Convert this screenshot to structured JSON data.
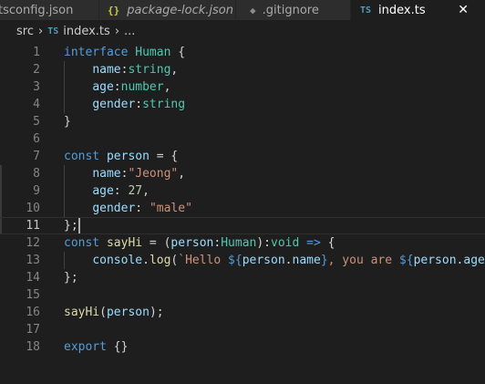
{
  "tabs": [
    {
      "label": "tsconfig.json",
      "icon": "",
      "italic": false,
      "active": false
    },
    {
      "label": "package-lock.json",
      "icon": "{}",
      "italic": true,
      "active": false
    },
    {
      "label": ".gitignore",
      "icon": "◆",
      "italic": false,
      "active": false
    },
    {
      "label": "index.ts",
      "icon": "TS",
      "italic": false,
      "active": true
    }
  ],
  "close_glyph": "✕",
  "breadcrumb": {
    "folder": "src",
    "file_icon": "TS",
    "file": "index.ts",
    "symbol": "..."
  },
  "editor": {
    "cursor_line": 11,
    "lines": [
      {
        "n": "1",
        "tokens": [
          {
            "t": "interface",
            "c": "k"
          },
          {
            "t": " ",
            "c": "p"
          },
          {
            "t": "Human",
            "c": "ty"
          },
          {
            "t": " {",
            "c": "p"
          }
        ]
      },
      {
        "n": "2",
        "tokens": [
          {
            "t": "    ",
            "c": "p"
          },
          {
            "t": "name",
            "c": "v"
          },
          {
            "t": ":",
            "c": "p"
          },
          {
            "t": "string",
            "c": "ty"
          },
          {
            "t": ",",
            "c": "p"
          }
        ]
      },
      {
        "n": "3",
        "tokens": [
          {
            "t": "    ",
            "c": "p"
          },
          {
            "t": "age",
            "c": "v"
          },
          {
            "t": ":",
            "c": "p"
          },
          {
            "t": "number",
            "c": "ty"
          },
          {
            "t": ",",
            "c": "p"
          }
        ]
      },
      {
        "n": "4",
        "tokens": [
          {
            "t": "    ",
            "c": "p"
          },
          {
            "t": "gender",
            "c": "v"
          },
          {
            "t": ":",
            "c": "p"
          },
          {
            "t": "string",
            "c": "ty"
          }
        ]
      },
      {
        "n": "5",
        "tokens": [
          {
            "t": "}",
            "c": "p"
          }
        ]
      },
      {
        "n": "6",
        "tokens": []
      },
      {
        "n": "7",
        "tokens": [
          {
            "t": "const",
            "c": "k"
          },
          {
            "t": " ",
            "c": "p"
          },
          {
            "t": "person",
            "c": "v"
          },
          {
            "t": " = {",
            "c": "p"
          }
        ]
      },
      {
        "n": "8",
        "tokens": [
          {
            "t": "    ",
            "c": "p"
          },
          {
            "t": "name",
            "c": "v"
          },
          {
            "t": ":",
            "c": "p"
          },
          {
            "t": "\"Jeong\"",
            "c": "s"
          },
          {
            "t": ",",
            "c": "p"
          }
        ]
      },
      {
        "n": "9",
        "tokens": [
          {
            "t": "    ",
            "c": "p"
          },
          {
            "t": "age",
            "c": "v"
          },
          {
            "t": ": ",
            "c": "p"
          },
          {
            "t": "27",
            "c": "n"
          },
          {
            "t": ",",
            "c": "p"
          }
        ]
      },
      {
        "n": "10",
        "tokens": [
          {
            "t": "    ",
            "c": "p"
          },
          {
            "t": "gender",
            "c": "v"
          },
          {
            "t": ": ",
            "c": "p"
          },
          {
            "t": "\"male\"",
            "c": "s"
          }
        ]
      },
      {
        "n": "11",
        "tokens": [
          {
            "t": "};",
            "c": "p"
          }
        ]
      },
      {
        "n": "12",
        "tokens": [
          {
            "t": "const",
            "c": "k"
          },
          {
            "t": " ",
            "c": "p"
          },
          {
            "t": "sayHi",
            "c": "f"
          },
          {
            "t": " = (",
            "c": "p"
          },
          {
            "t": "person",
            "c": "v"
          },
          {
            "t": ":",
            "c": "p"
          },
          {
            "t": "Human",
            "c": "ty"
          },
          {
            "t": "):",
            "c": "p"
          },
          {
            "t": "void",
            "c": "ty"
          },
          {
            "t": " ",
            "c": "p"
          },
          {
            "t": "=>",
            "c": "k"
          },
          {
            "t": " {",
            "c": "p"
          }
        ]
      },
      {
        "n": "13",
        "tokens": [
          {
            "t": "    ",
            "c": "p"
          },
          {
            "t": "console",
            "c": "v"
          },
          {
            "t": ".",
            "c": "p"
          },
          {
            "t": "log",
            "c": "f"
          },
          {
            "t": "(",
            "c": "p"
          },
          {
            "t": "`Hello ",
            "c": "s"
          },
          {
            "t": "${",
            "c": "tv"
          },
          {
            "t": "person",
            "c": "v"
          },
          {
            "t": ".",
            "c": "p"
          },
          {
            "t": "name",
            "c": "v"
          },
          {
            "t": "}",
            "c": "tv"
          },
          {
            "t": ", you are ",
            "c": "s"
          },
          {
            "t": "${",
            "c": "tv"
          },
          {
            "t": "person",
            "c": "v"
          },
          {
            "t": ".",
            "c": "p"
          },
          {
            "t": "age",
            "c": "v"
          },
          {
            "t": "}",
            "c": "tv"
          }
        ]
      },
      {
        "n": "14",
        "tokens": [
          {
            "t": "};",
            "c": "p"
          }
        ]
      },
      {
        "n": "15",
        "tokens": []
      },
      {
        "n": "16",
        "tokens": [
          {
            "t": "sayHi",
            "c": "f"
          },
          {
            "t": "(",
            "c": "p"
          },
          {
            "t": "person",
            "c": "v"
          },
          {
            "t": ");",
            "c": "p"
          }
        ]
      },
      {
        "n": "17",
        "tokens": []
      },
      {
        "n": "18",
        "tokens": [
          {
            "t": "export",
            "c": "k"
          },
          {
            "t": " {}",
            "c": "p"
          }
        ]
      }
    ]
  }
}
